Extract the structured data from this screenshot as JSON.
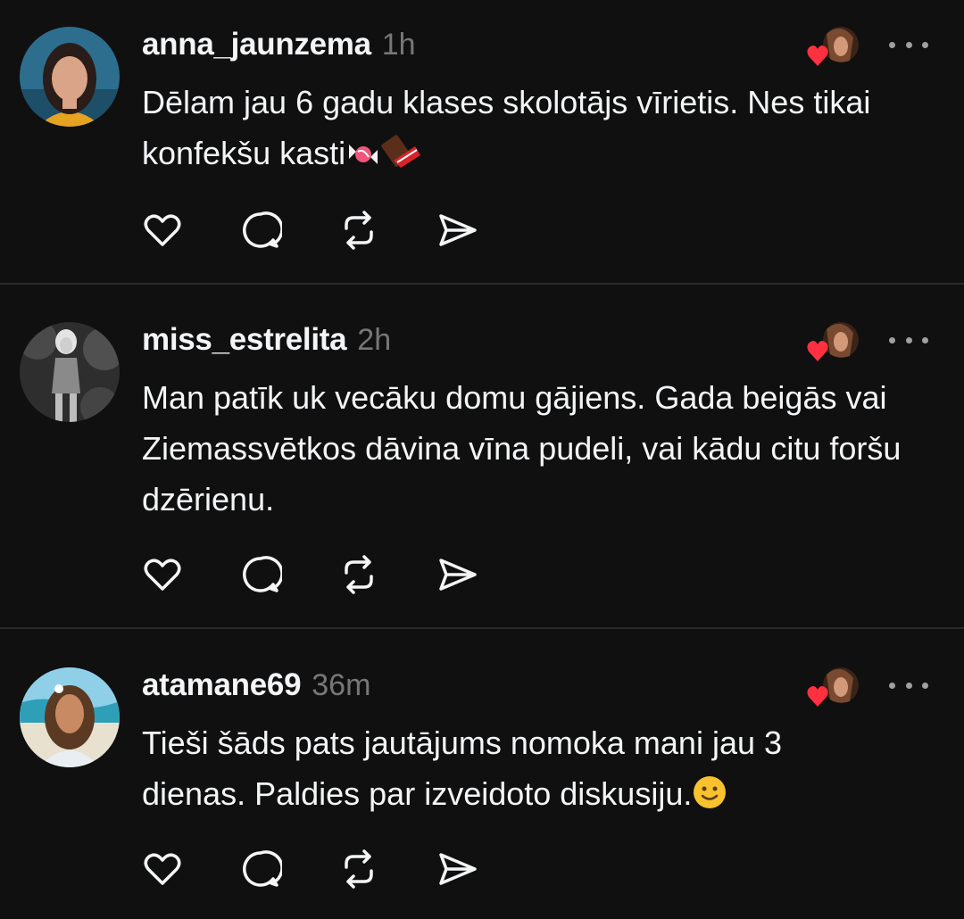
{
  "posts": [
    {
      "username": "anna_jaunzema",
      "time": "1h",
      "text": "Dēlam jau 6 gadu klases skolotājs vīrietis. Nes tikai konfekšu kasti",
      "emoji_icons": [
        "candy-icon",
        "chocolate-bar-icon"
      ],
      "avatar_colors": {
        "bg": "#2d6e8f",
        "skin": "#d9a488",
        "hair": "#2a1c18",
        "shirt": "#e6a321"
      }
    },
    {
      "username": "miss_estrelita",
      "time": "2h",
      "text": "Man patīk uk vecāku domu gājiens. Gada beigās vai Ziemassvētkos dāvina vīna pudeli, vai kādu citu foršu dzērienu.",
      "emoji_icons": [],
      "avatar_colors": {
        "bg": "#3a3a3a",
        "skin": "#cfcfcf",
        "hair": "#e4e4e4",
        "shirt": "#8a8a8a"
      }
    },
    {
      "username": "atamane69",
      "time": "36m",
      "text": "Tieši šāds pats jautājums nomoka mani jau 3 dienas. Paldies par izveidoto diskusiju.",
      "emoji_icons": [
        "slightly-smiling-face-icon"
      ],
      "avatar_colors": {
        "bg": "#8fd0e8",
        "skin": "#c88a62",
        "hair": "#5a3a22",
        "shirt": "#e9eef2"
      }
    }
  ],
  "colors": {
    "background": "#101010",
    "text": "#f3f5f7",
    "muted": "#777777",
    "divider": "#2a2a2a",
    "like_heart": "#ff3040"
  }
}
